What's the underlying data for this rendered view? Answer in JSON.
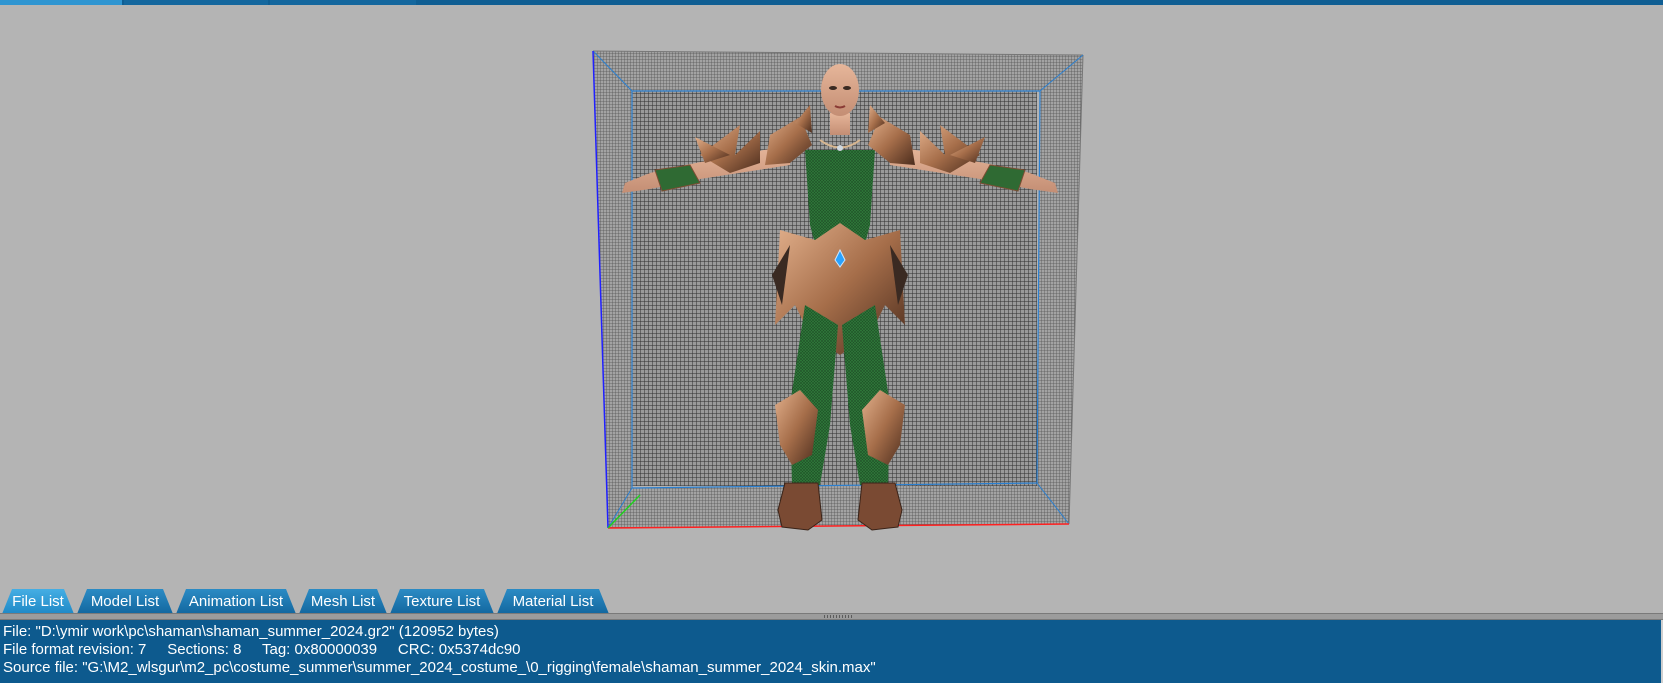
{
  "colors": {
    "background": "#b4b4b4",
    "accent": "#1a76b3",
    "panel": "#0d5a8e",
    "grid": "#2f2f2f",
    "bbox_edge": "#2a7fd0"
  },
  "tabs": [
    {
      "label": "File List",
      "active": true
    },
    {
      "label": "Model List",
      "active": false
    },
    {
      "label": "Animation List",
      "active": false
    },
    {
      "label": "Mesh List",
      "active": false
    },
    {
      "label": "Texture List",
      "active": false
    },
    {
      "label": "Material List",
      "active": false
    }
  ],
  "info": {
    "file": "File: \"D:\\ymir work\\pc\\shaman\\shaman_summer_2024.gr2\" (120952 bytes)",
    "format": "File format revision: 7     Sections: 8     Tag: 0x80000039     CRC: 0x5374dc90",
    "source": "Source file: \"G:\\M2_wlsgur\\m2_pc\\costume_summer\\summer_2024_costume_\\0_rigging\\female\\shaman_summer_2024_skin.max\""
  },
  "viewport": {
    "model_name": "shaman_summer_2024",
    "outfit_color": "#2f7a3a",
    "armor_color": "#b07a55"
  }
}
